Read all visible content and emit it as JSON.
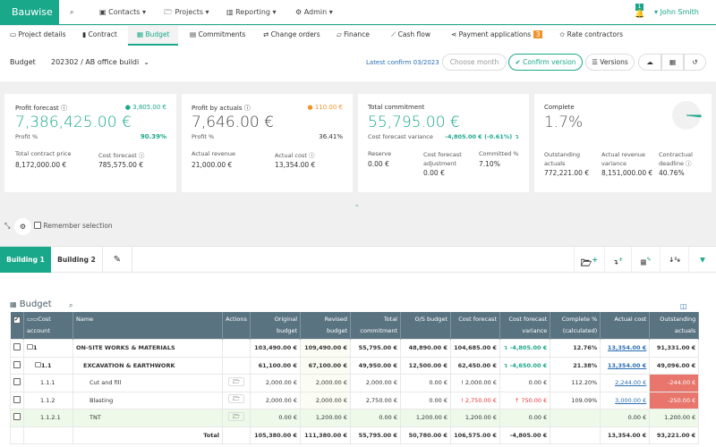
{
  "app": {
    "logo": "Bauwise",
    "user": "John Smith",
    "notifications": "1"
  },
  "nav": [
    {
      "label": "Contacts",
      "icon": "contacts-icon"
    },
    {
      "label": "Projects",
      "icon": "folder-icon"
    },
    {
      "label": "Reporting",
      "icon": "chart-icon"
    },
    {
      "label": "Admin",
      "icon": "gear-icon"
    }
  ],
  "subtabs": [
    {
      "label": "Project details"
    },
    {
      "label": "Contract"
    },
    {
      "label": "Budget",
      "active": true
    },
    {
      "label": "Commitments"
    },
    {
      "label": "Change orders"
    },
    {
      "label": "Finance"
    },
    {
      "label": "Cash flow"
    },
    {
      "label": "Payment applications",
      "badge": "3"
    },
    {
      "label": "Rate contractors"
    }
  ],
  "budget_bar": {
    "label": "Budget",
    "selected": "202302 / AB office buildi",
    "latest": "Latest confirm 03/2023",
    "month_placeholder": "Choose month",
    "confirm": "Confirm version",
    "versions": "Versions"
  },
  "cards": {
    "profit_forecast": {
      "title": "Profit forecast",
      "badge": "3,805.00 €",
      "value": "7,386,425.00 €",
      "sub_label": "Profit %",
      "sub_value": "90.39%",
      "f1_label": "Total contract price",
      "f1_value": "8,172,000.00 €",
      "f2_label": "Cost forecast",
      "f2_value": "785,575.00 €"
    },
    "profit_actuals": {
      "title": "Profit by actuals",
      "badge": "110.00 €",
      "value": "7,646.00 €",
      "sub_label": "Profit %",
      "sub_value": "36.41%",
      "f1_label": "Actual revenue",
      "f1_value": "21,000.00 €",
      "f2_label": "Actual cost",
      "f2_value": "13,354.00 €"
    },
    "commitment": {
      "title": "Total commitment",
      "value": "55,795.00 €",
      "sub_label": "Cost forecast variance",
      "sub_value": "-4,805.00 € (-0.61%)",
      "f1_label": "Reserve",
      "f1_value": "0.00 €",
      "f2_label": "Cost forecast adjustment",
      "f2_value": "0.00 €",
      "f3_label": "Committed %",
      "f3_value": "7.10%"
    },
    "complete": {
      "title": "Complete",
      "value": "1.7%",
      "percent": 1.7,
      "f1_label": "Outstanding actuals",
      "f1_value": "772,221.00 €",
      "f2_label": "Actual revenue variance",
      "f2_value": "8,151,000.00 €",
      "f3_label": "Contractual deadline",
      "f3_value": "40.76%"
    }
  },
  "toolbar": {
    "remember": "Remember selection"
  },
  "building_tabs": [
    {
      "label": "Building 1",
      "active": true
    },
    {
      "label": "Building 2"
    }
  ],
  "table": {
    "title": "Budget",
    "columns": [
      "Cost account",
      "Name",
      "Actions",
      "Original budget",
      "Revised budget",
      "Total commitment",
      "O/S budget",
      "Cost forecast",
      "Cost forecast variance",
      "Complete % (calculated)",
      "Actual cost",
      "Outstanding actuals"
    ],
    "rows": [
      {
        "level": 0,
        "account": "1",
        "name": "ON-SITE WORKS & MATERIALS",
        "values": [
          "103,490.00 €",
          "109,490.00 €",
          "55,795.00 €",
          "48,890.00 €",
          "104,685.00 €",
          "-4,805.00 €",
          "12.76%",
          "13,354.00 €",
          "91,331.00 €"
        ]
      },
      {
        "level": 1,
        "account": "1.1",
        "name": "EXCAVATION & EARTHWORK",
        "values": [
          "61,100.00 €",
          "67,100.00 €",
          "49,950.00 €",
          "12,500.00 €",
          "62,450.00 €",
          "-4,650.00 €",
          "21.38%",
          "13,354.00 €",
          "49,096.00 €"
        ]
      },
      {
        "level": 2,
        "account": "1.1.1",
        "name": "Cut and fill",
        "values": [
          "2,000.00 €",
          "2,000.00 €",
          "2,000.00 €",
          "0.00 €",
          "2,000.00 €",
          "0.00 €",
          "112.20%",
          "2,244.00 €",
          "-244.00 €"
        ]
      },
      {
        "level": 2,
        "account": "1.1.2",
        "name": "Blasting",
        "values": [
          "2,000.00 €",
          "2,000.00 €",
          "2,750.00 €",
          "0.00 €",
          "2,750.00 €",
          "750.00 €",
          "109.09%",
          "3,000.00 €",
          "-250.00 €"
        ]
      },
      {
        "level": 3,
        "account": "1.1.2.1",
        "name": "TNT",
        "values": [
          "0.00 €",
          "1,200.00 €",
          "0.00 €",
          "1,200.00 €",
          "1,200.00 €",
          "0.00 €",
          "",
          "0.00 €",
          "1,200.00 €"
        ]
      }
    ],
    "total": {
      "label": "Total",
      "values": [
        "105,380.00 €",
        "111,380.00 €",
        "55,795.00 €",
        "50,780.00 €",
        "106,575.00 €",
        "-4,805.00 €",
        "",
        "13,354.00 €",
        "93,221.00 €"
      ]
    }
  },
  "colors": {
    "accent": "#1aa88a",
    "header": "#5a7381",
    "warning": "#f0932b",
    "danger": "#e8766c"
  }
}
